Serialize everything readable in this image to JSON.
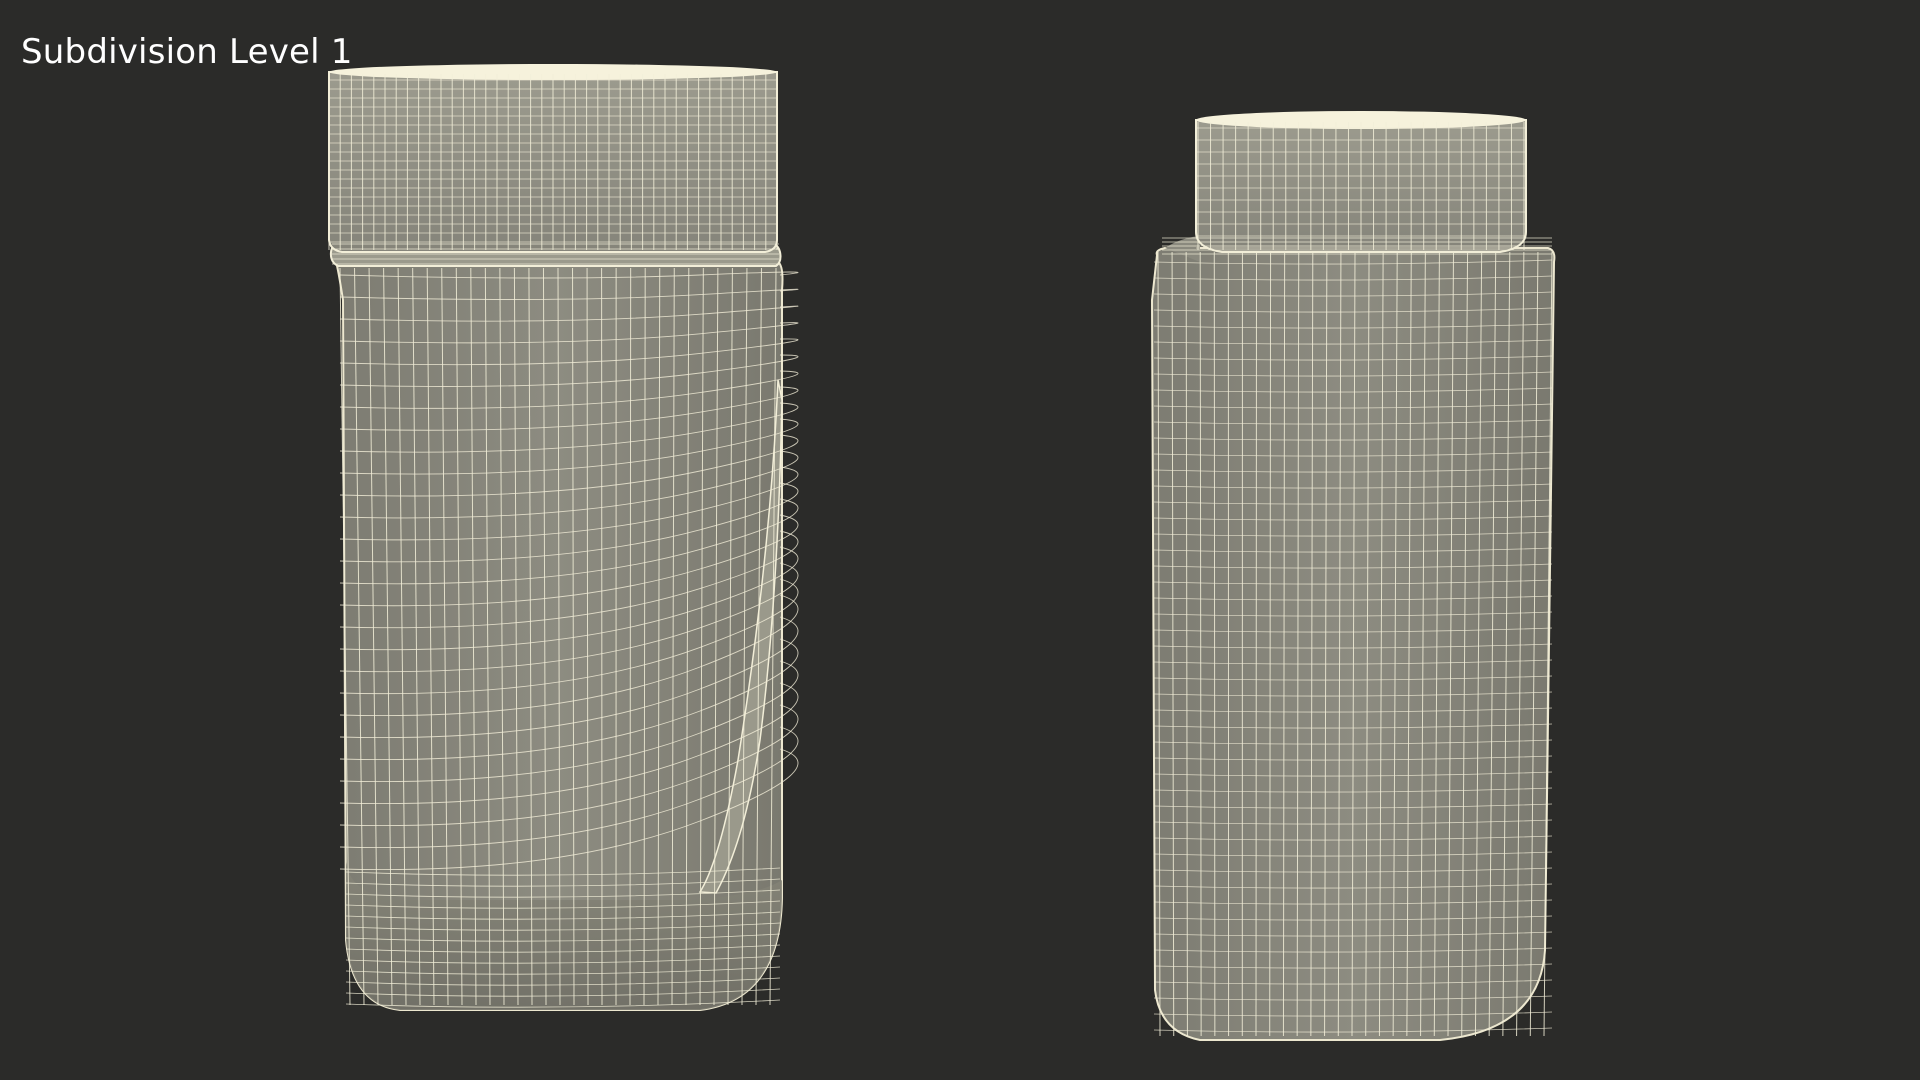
{
  "viewport": {
    "label": "Subdivision Level 1",
    "background": "#2b2b29"
  },
  "colors": {
    "surface": "#8a897e",
    "surface_dark": "#6f6e65",
    "surface_light": "#a3a294",
    "wire": "#f2eed8",
    "cap_top": "#f6f2dc"
  },
  "objects": [
    {
      "name": "jar-with-handle-grip",
      "parts": [
        "lid",
        "neck-ring",
        "body",
        "base-band",
        "side-grip-groove"
      ]
    },
    {
      "name": "square-jar-with-round-cap",
      "parts": [
        "cap",
        "shoulder",
        "body"
      ]
    }
  ]
}
